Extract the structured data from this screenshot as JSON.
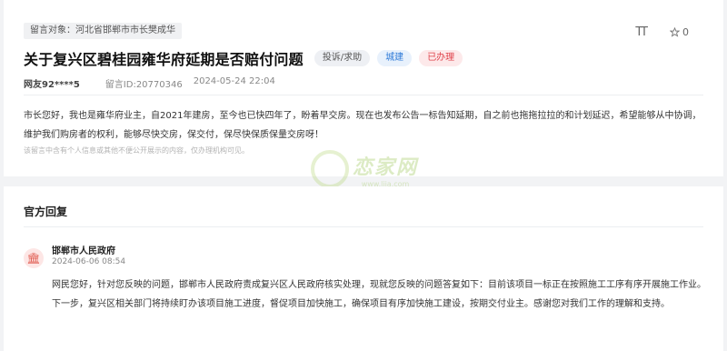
{
  "message": {
    "target_tag": "留言对象：河北省邯郸市市长樊成华",
    "title": "关于复兴区碧桂园雍华府延期是否赔付问题",
    "tags": [
      "投诉/求助",
      "城建",
      "已办理"
    ],
    "user": "网友92****5",
    "message_id": "留言ID:20770346",
    "date": "2024-05-24 22:04",
    "content": "市长您好，我也是雍华府业主，自2021年建房，至今也已快四年了，盼着早交房。现在也发布公告一标告知延期，自之前也拖拖拉拉的和计划延迟，希望能够从中协调，维护我们购房者的权利，能够尽快交房，保交付，保尽快保质保量交房呀！",
    "notice": "该留言中含有个人信息或其他不便公开展示的内容，仅办理机构可见。",
    "tools": {
      "font_icon_label": "TT",
      "fav_count": "0"
    }
  },
  "watermark": {
    "main": "恋家网",
    "sub": "www.ljia.com"
  },
  "reply": {
    "section_title": "官方回复",
    "org": "邯郸市人民政府",
    "date": "2024-06-06 08:54",
    "content": "网民您好，针对您反映的问题，邯郸市人民政府责成复兴区人民政府核实处理，现就您反映的问题答复如下：目前该项目一标正在按照施工工序有序开展施工作业。下一步，复兴区相关部门将持续盯办该项目施工进度，督促项目加快施工，确保项目有序加快施工建设，按期交付业主。感谢您对我们工作的理解和支持。"
  }
}
